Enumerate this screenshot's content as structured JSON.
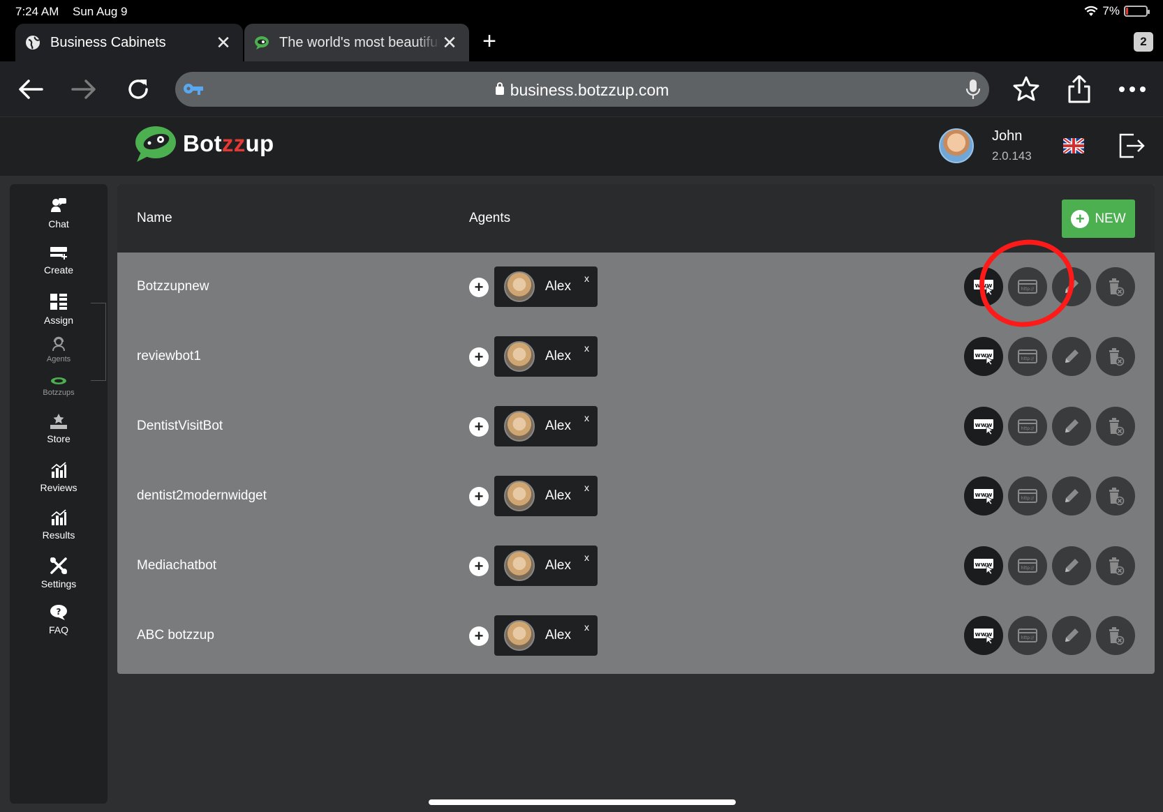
{
  "status_bar": {
    "time": "7:24 AM",
    "date": "Sun Aug 9",
    "battery": "7%",
    "battery_level": 0.07
  },
  "tabs": [
    {
      "title": "Business Cabinets",
      "active": true,
      "icon": "globe-icon"
    },
    {
      "title": "The world's most beautiful",
      "active": false,
      "icon": "botzzup-favicon"
    }
  ],
  "tab_count": "2",
  "browser": {
    "url": "business.botzzup.com"
  },
  "app": {
    "brand": {
      "part1": "Bot",
      "part2": "zz",
      "part3": "up"
    },
    "user": {
      "name": "John",
      "version": "2.0.143",
      "language": "en-GB"
    }
  },
  "sidebar": {
    "items": [
      {
        "label": "Chat",
        "icon": "chat-icon"
      },
      {
        "label": "Create",
        "icon": "create-icon"
      },
      {
        "label": "Assign",
        "icon": "assign-icon"
      },
      {
        "label": "Agents",
        "icon": "agent-icon"
      },
      {
        "label": "Botzzups",
        "icon": "botzzup-icon"
      },
      {
        "label": "Store",
        "icon": "store-icon"
      },
      {
        "label": "Reviews",
        "icon": "reviews-icon"
      },
      {
        "label": "Results",
        "icon": "results-icon"
      },
      {
        "label": "Settings",
        "icon": "settings-icon"
      },
      {
        "label": "FAQ",
        "icon": "faq-icon"
      }
    ]
  },
  "table": {
    "headers": {
      "name": "Name",
      "agents": "Agents"
    },
    "new_button": "NEW",
    "rows": [
      {
        "name": "Botzzupnew",
        "agent": "Alex",
        "remove": "x"
      },
      {
        "name": "reviewbot1",
        "agent": "Alex",
        "remove": "x"
      },
      {
        "name": "DentistVisitBot",
        "agent": "Alex",
        "remove": "x"
      },
      {
        "name": "dentist2modernwidget",
        "agent": "Alex",
        "remove": "x"
      },
      {
        "name": "Mediachatbot",
        "agent": "Alex",
        "remove": "x"
      },
      {
        "name": "ABC botzzup",
        "agent": "Alex",
        "remove": "x"
      }
    ],
    "row_actions": [
      "website-widget-icon",
      "http-link-icon",
      "edit-icon",
      "delete-icon"
    ]
  },
  "colors": {
    "accent": "#4caf50",
    "highlight": "#ff1a1a",
    "brand_red": "#e53935"
  }
}
